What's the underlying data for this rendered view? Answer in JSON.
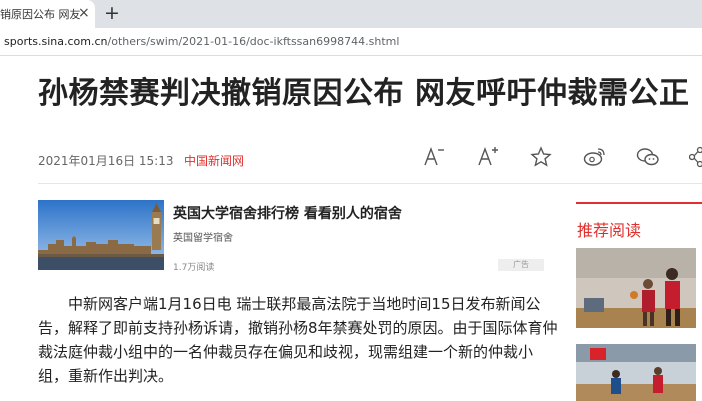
{
  "browser": {
    "tab_title": "销原因公布 网友",
    "tab_close": "×",
    "new_tab": "+",
    "url_host": "sports.sina.com.cn",
    "url_path": "/others/swim/2021-01-16/doc-ikftssan6998744.shtml"
  },
  "article": {
    "headline": "孙杨禁赛判决撤销原因公布 网友呼吁仲裁需公正",
    "date": "2021年01月16日 15:13",
    "source": "中国新闻网",
    "toolbar": [
      "font-decrease-icon",
      "font-increase-icon",
      "star-icon",
      "weibo-icon",
      "wechat-icon",
      "share-icon"
    ],
    "paragraph": "中新网客户端1月16日电 瑞士联邦最高法院于当地时间15日发布新闻公告，解释了即前支持孙杨诉请，撤销孙杨8年禁赛处罚的原因。由于国际体育仲裁法庭仲裁小组中的一名仲裁员存在偏见和歧视，现需组建一个新的仲裁小组，重新作出判决。"
  },
  "ad": {
    "title": "英国大学宿舍排行榜 看看别人的宿舍",
    "subtitle": "英国留学宿舍",
    "views": "1.7万阅读",
    "badge": "广告"
  },
  "rail": {
    "title": "推荐阅读"
  },
  "colors": {
    "accent": "#e0302d",
    "tabbar": "#dee1e6"
  }
}
